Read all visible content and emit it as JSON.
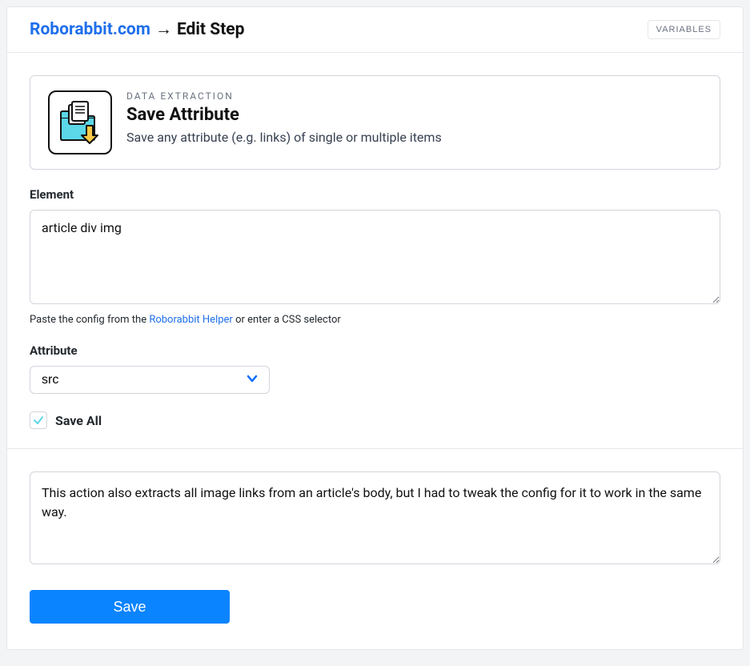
{
  "header": {
    "site_link": "Roborabbit.com",
    "arrow": "→",
    "page_title": "Edit Step",
    "variables_label": "VARIABLES"
  },
  "step": {
    "category": "DATA EXTRACTION",
    "title": "Save Attribute",
    "description": "Save any attribute (e.g. links) of single or multiple items"
  },
  "element": {
    "label": "Element",
    "value": "article div img",
    "helper_prefix": "Paste the config from the ",
    "helper_link": "Roborabbit Helper",
    "helper_suffix": " or enter a CSS selector"
  },
  "attribute": {
    "label": "Attribute",
    "value": "src"
  },
  "save_all": {
    "label": "Save All",
    "checked": true
  },
  "note": {
    "value": "This action also extracts all image links from an article's body, but I had to tweak the config for it to work in the same way."
  },
  "actions": {
    "save_label": "Save"
  }
}
